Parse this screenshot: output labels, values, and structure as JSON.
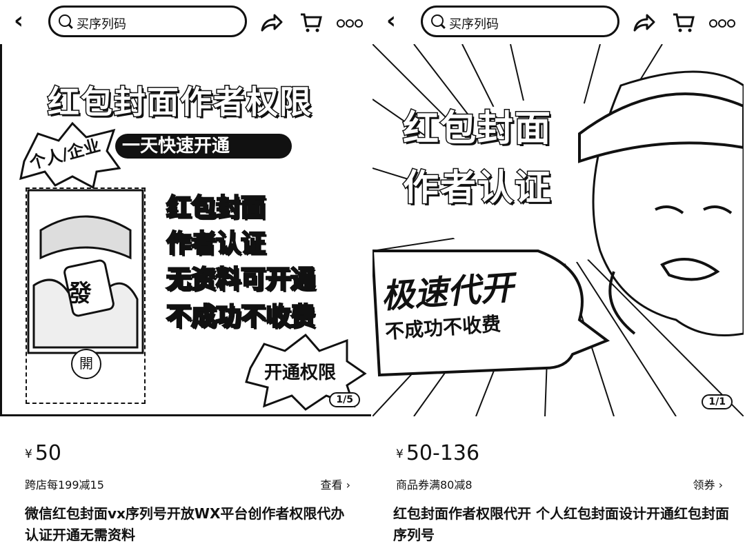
{
  "search": {
    "placeholder": "买序列码"
  },
  "left": {
    "banner": {
      "title": "红包封面作者权限",
      "tag": "个人/企业",
      "badge": "一天快速开通",
      "lines": [
        "红包封面",
        "作者认证",
        "无资料可开通",
        "不成功不收费"
      ],
      "cover_char": "發",
      "cover_btn": "開",
      "bubble": "开通权限",
      "counter": "1/5"
    },
    "price": "50",
    "currency": "¥",
    "promo": "跨店每199减15",
    "link": "查看 ›",
    "title": "微信红包封面vx序列号开放WX平台创作者权限代办认证开通无需资料"
  },
  "right": {
    "banner": {
      "title1": "红包封面",
      "title2": "作者认证",
      "sign1": "极速代开",
      "sign2": "不成功不收费",
      "counter": "1/1"
    },
    "price": "50-136",
    "currency": "¥",
    "promo": "商品券满80减8",
    "link": "领券 ›",
    "title": "红包封面作者权限代开 个人红包封面设计开通红包封面序列号"
  }
}
